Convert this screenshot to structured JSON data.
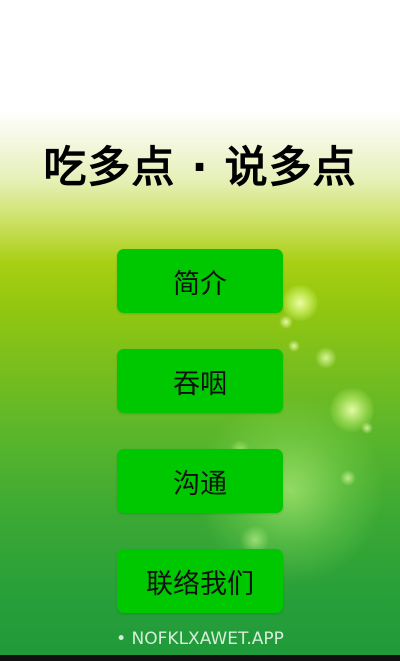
{
  "header": {
    "title": "吃多点 · 说多点"
  },
  "menu": {
    "items": [
      {
        "label": "简介"
      },
      {
        "label": "吞咽"
      },
      {
        "label": "沟通"
      },
      {
        "label": "联络我们"
      }
    ]
  },
  "watermark": {
    "text": "• NOFKLXAWET.APP"
  },
  "colors": {
    "button_bg": "#00c800",
    "background_top": "#ffffff",
    "background_mid": "#a9cf14",
    "background_bottom": "#1f9a3b"
  }
}
